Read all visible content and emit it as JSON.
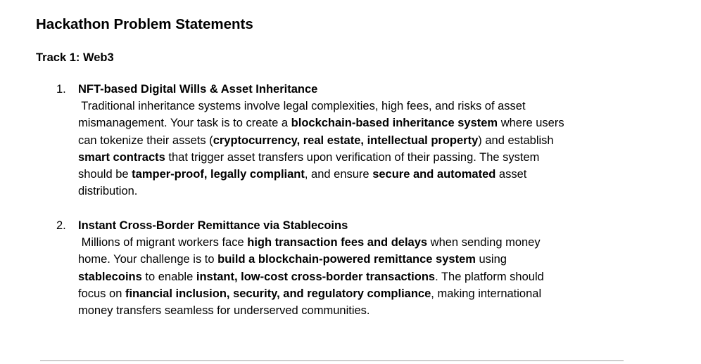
{
  "document": {
    "title": "Hackathon Problem Statements",
    "track_heading": "Track 1: Web3"
  },
  "problems": [
    {
      "number": "1.",
      "title": "NFT-based Digital Wills & Asset Inheritance",
      "lines": [
        [
          {
            "t": " Traditional inheritance systems involve legal complexities, high fees, and risks of asset",
            "b": false
          }
        ],
        [
          {
            "t": "mismanagement. Your task is to create a ",
            "b": false
          },
          {
            "t": "blockchain-based inheritance system",
            "b": true
          },
          {
            "t": " where users",
            "b": false
          }
        ],
        [
          {
            "t": "can tokenize their assets (",
            "b": false
          },
          {
            "t": "cryptocurrency, real estate, intellectual property",
            "b": true
          },
          {
            "t": ") and establish",
            "b": false
          }
        ],
        [
          {
            "t": "smart contracts",
            "b": true
          },
          {
            "t": " that trigger asset transfers upon verification of their passing. The system",
            "b": false
          }
        ],
        [
          {
            "t": "should be ",
            "b": false
          },
          {
            "t": "tamper-proof, legally compliant",
            "b": true
          },
          {
            "t": ", and ensure ",
            "b": false
          },
          {
            "t": "secure and automated",
            "b": true
          },
          {
            "t": " asset",
            "b": false
          }
        ],
        [
          {
            "t": "distribution.",
            "b": false
          }
        ]
      ]
    },
    {
      "number": "2.",
      "title": "Instant Cross-Border Remittance via Stablecoins",
      "lines": [
        [
          {
            "t": " Millions of migrant workers face ",
            "b": false
          },
          {
            "t": "high transaction fees and delays",
            "b": true
          },
          {
            "t": " when sending money",
            "b": false
          }
        ],
        [
          {
            "t": "home. Your challenge is to ",
            "b": false
          },
          {
            "t": "build a blockchain-powered remittance system",
            "b": true
          },
          {
            "t": " using",
            "b": false
          }
        ],
        [
          {
            "t": "stablecoins",
            "b": true
          },
          {
            "t": " to enable ",
            "b": false
          },
          {
            "t": "instant, low-cost cross-border transactions",
            "b": true
          },
          {
            "t": ". The platform should",
            "b": false
          }
        ],
        [
          {
            "t": "focus on ",
            "b": false
          },
          {
            "t": "financial inclusion, security, and regulatory compliance",
            "b": true
          },
          {
            "t": ", making international",
            "b": false
          }
        ],
        [
          {
            "t": "money transfers seamless for underserved communities.",
            "b": false
          }
        ]
      ]
    }
  ]
}
